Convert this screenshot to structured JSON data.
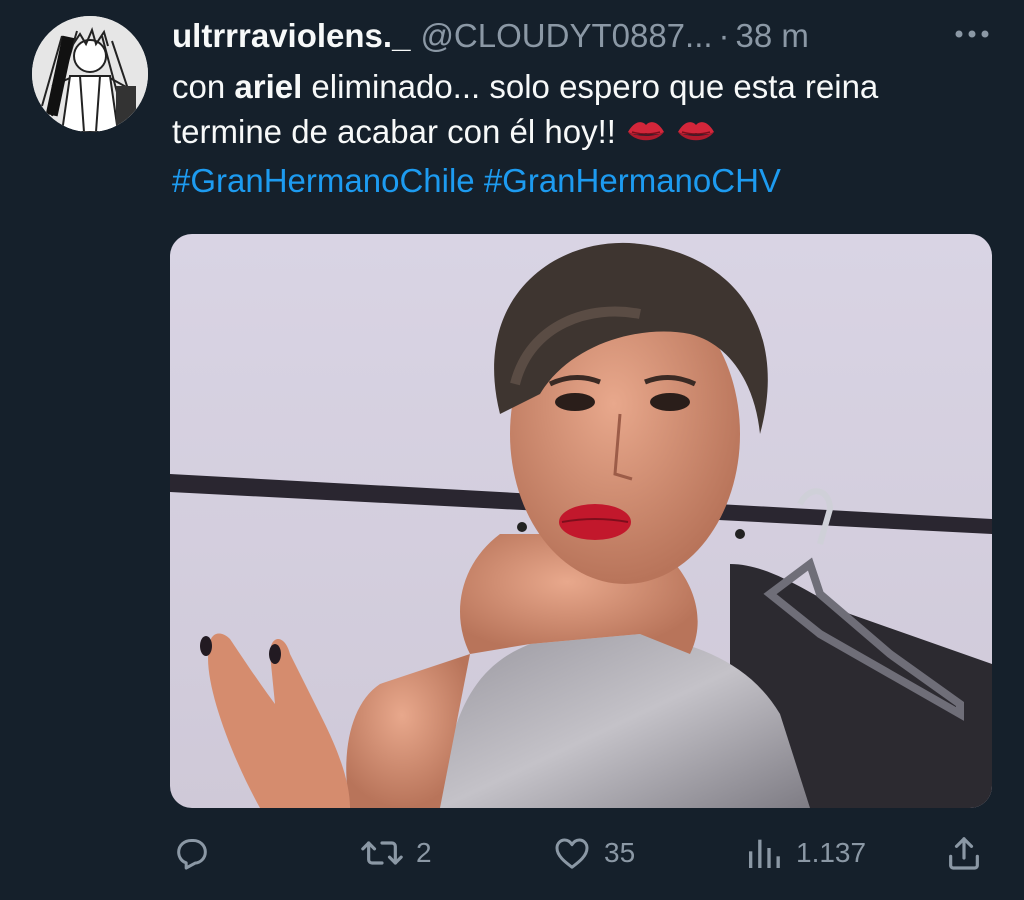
{
  "tweet": {
    "display_name": "ultrrraviolens._",
    "handle": "@CLOUDYT0887...",
    "separator": "·",
    "time": "38 m",
    "text_part1": "con ",
    "text_bold": "ariel",
    "text_part2": " eliminado... solo espero que esta reina termine de acabar con él hoy!!",
    "emojis": [
      "💋",
      "💋"
    ],
    "hashtags": [
      "#GranHermanoChile",
      "#GranHermanoCHV"
    ]
  },
  "actions": {
    "reply_count": "",
    "retweet_count": "2",
    "like_count": "35",
    "views_count": "1.137"
  },
  "colors": {
    "background": "#15202b",
    "text": "#f7f9f9",
    "secondary": "#8b98a5",
    "link": "#1d9bf0",
    "kiss": "#d3263a"
  },
  "icons": {
    "more": "more-dots-icon",
    "reply": "reply-icon",
    "retweet": "retweet-icon",
    "like": "heart-icon",
    "views": "views-icon",
    "share": "share-icon"
  }
}
